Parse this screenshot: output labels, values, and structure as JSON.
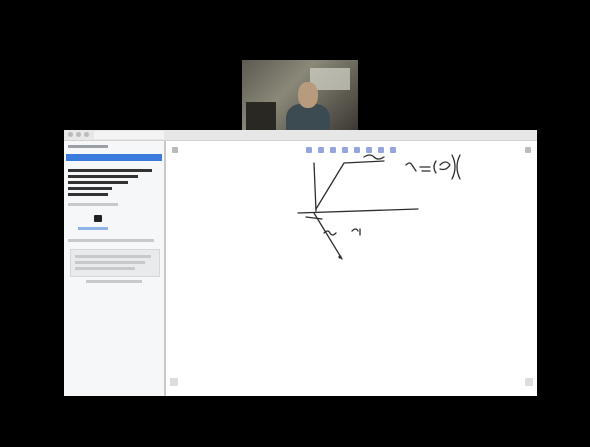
{
  "window": {
    "tab_title": ""
  },
  "sidepanel": {
    "header_label": ""
  },
  "colors": {
    "background": "#000000",
    "panel_header": "#3b7bdc",
    "toolbar_icons": "#7a8fd8",
    "ink": "#333333"
  }
}
